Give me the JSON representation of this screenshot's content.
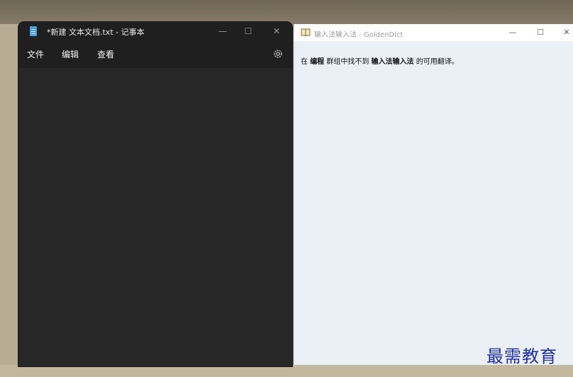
{
  "notepad": {
    "title": "*新建 文本文档.txt - 记事本",
    "controls": {
      "minimize": "—",
      "maximize": "☐",
      "close": "✕"
    },
    "menu": [
      "文件",
      "编辑",
      "查看"
    ],
    "settings_icon": "gear-icon",
    "colors": {
      "background": "#272727",
      "titlebar": "#1f1f1f",
      "icon": "#4a9ee0"
    }
  },
  "goldendict": {
    "title": "输入法输入法 - GoldenDict",
    "controls": {
      "minimize": "—",
      "maximize": "☐",
      "close": "✕"
    },
    "message": {
      "prefix": "在 ",
      "group": "编程",
      "mid": " 群组中找不到 ",
      "word": "输入法输入法",
      "suffix": " 的可用翻译。"
    },
    "colors": {
      "background": "#eaf0f6"
    }
  },
  "watermark": "最需教育"
}
